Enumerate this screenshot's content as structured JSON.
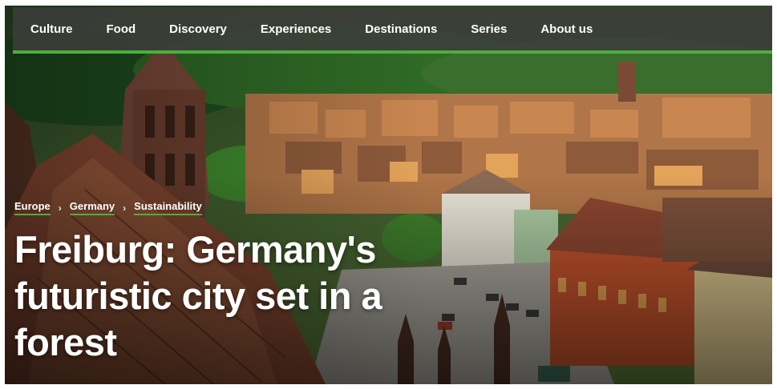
{
  "nav": {
    "items": [
      "Culture",
      "Food",
      "Discovery",
      "Experiences",
      "Destinations",
      "Series",
      "About us"
    ]
  },
  "breadcrumb": {
    "items": [
      "Europe",
      "Germany",
      "Sustainability"
    ],
    "separator": "›"
  },
  "article": {
    "title": "Freiburg: Germany's futuristic city set in a forest"
  },
  "hero": {
    "subject": "aerial-view-freiburg-old-town"
  },
  "colors": {
    "accent": "#4caf3d",
    "nav_bg": "#3c3e3a"
  }
}
